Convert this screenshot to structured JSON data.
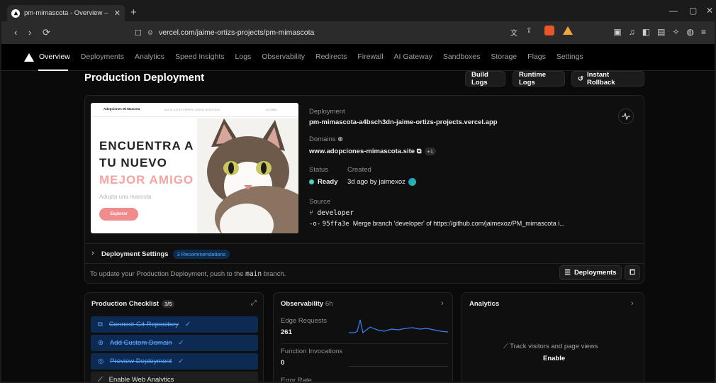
{
  "browser": {
    "tab_title": "pm-mimascota - Overview – Ver",
    "url": "vercel.com/jaime-ortizs-projects/pm-mimascota"
  },
  "nav": {
    "items": [
      "Overview",
      "Deployments",
      "Analytics",
      "Speed Insights",
      "Logs",
      "Observability",
      "Redirects",
      "Firewall",
      "AI Gateway",
      "Sandboxes",
      "Storage",
      "Flags",
      "Settings"
    ],
    "active": "Overview"
  },
  "page": {
    "title": "Production Deployment",
    "buttons": {
      "build_logs": "Build Logs",
      "runtime_logs": "Runtime Logs",
      "instant_rollback": "Instant Rollback"
    }
  },
  "preview": {
    "logo": "Adopciones Mi Mascota",
    "nav_links": "INICIO   GATOS   PERROS   VIDEOS   NOSOTROS",
    "access": "ACCEDER",
    "headline_1": "ENCUENTRA A",
    "headline_2": "TU NUEVO",
    "headline_3": "MEJOR AMIGO",
    "subtitle": "Adopta una mascota",
    "cta": "Explorar"
  },
  "deployment": {
    "label": "Deployment",
    "url": "pm-mimascota-a4bsch3dn-jaime-ortizs-projects.vercel.app",
    "domains_label": "Domains",
    "domain": "www.adopciones-mimascota.site",
    "domain_extra": "+1",
    "status_label": "Status",
    "status": "Ready",
    "created_label": "Created",
    "created": "3d ago by jaimexoz",
    "source_label": "Source",
    "branch": "developer",
    "commit_hash": "95ffa3e",
    "commit_msg": "Merge branch 'developer' of https://github.com/jaimexoz/PM_mimascota i..."
  },
  "settings_row": {
    "label": "Deployment Settings",
    "badge": "3 Recommendations"
  },
  "footer_row": {
    "text_prefix": "To update your Production Deployment, push to the",
    "branch": "main",
    "text_suffix": "branch.",
    "deployments_btn": "Deployments"
  },
  "checklist": {
    "title": "Production Checklist",
    "count": "3/5",
    "items": [
      {
        "label": "Connect Git Repository",
        "done": true
      },
      {
        "label": "Add Custom Domain",
        "done": true
      },
      {
        "label": "Preview Deployment",
        "done": true
      },
      {
        "label": "Enable Web Analytics",
        "done": false
      }
    ]
  },
  "observability": {
    "title": "Observability",
    "period": "6h",
    "edge_label": "Edge Requests",
    "edge_value": "261",
    "fn_label": "Function Invocations",
    "fn_value": "0",
    "err_label": "Error Rate"
  },
  "analytics": {
    "title": "Analytics",
    "track_text": "Track visitors and page views",
    "enable": "Enable"
  }
}
